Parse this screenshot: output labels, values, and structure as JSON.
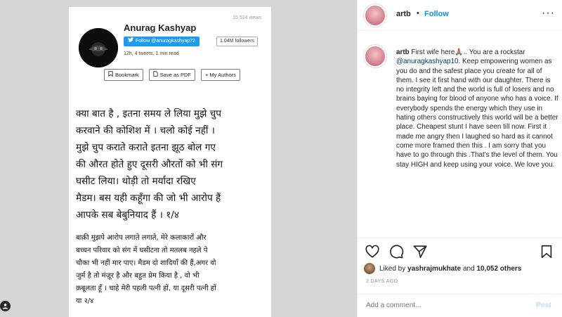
{
  "post_image": {
    "author_name": "Anurag Kashyap",
    "views": "15,524 views",
    "follow_label": "Follow @anuragkashyap72",
    "followers": "1.04M followers",
    "meta": "12h, 4 tweets, 1 min read",
    "bookmark": "Bookmark",
    "save_pdf": "Save as PDF",
    "my_authors": "+ My Authors",
    "hindi_main": [
      "क्या बात है , इतना समय ले लिया मुझे चुप",
      "करवाने की कोशिश में । चलो कोई नहीं ।",
      "मुझे चुप कराते कराते इतना झूठ बोल गए",
      "की औरत होते हुए दूसरी औरतों को भी संग",
      "घसीट लिया। थोड़ी तो मर्यादा रखिए",
      "मैडम। बस यही कहूँगा की जो भी आरोप हैं",
      "आपके सब बेबुनियाद हैं । १/४"
    ],
    "hindi_sub": [
      "बाक़ी मुझपे आरोप लगाते लगाते, मेरे कलाकारों और",
      "बच्चन परिवार को संग में घसीटना तो मतलब नहले पे",
      "चौका भी नहीं मार पाए। मैडम दो शादियाँ की हैं,अगर वो",
      "जुर्म है तो मंज़ूर है और बहुत प्रेम किया है , वो भी",
      "क़बूलता हूँ । चाहे मेरी पहली पत्नी हों, या दूसरी पत्नी हों",
      "या २/४"
    ]
  },
  "header": {
    "username": "artb",
    "dot": "•",
    "follow": "Follow",
    "more": "···"
  },
  "comment": {
    "username": "artb",
    "before_mention": "First wife here🙏🏽.. You are a rockstar ",
    "mention": "@anuragkashyap10",
    "after_mention": ". Keep empowering women as you do and the safest place you create for all of them. I see it first hand with our daughter. There is no integrity left and the world is full of losers and no brains baying for blood of anyone who has a voice. If everybody spends the energy which they use in hating others constructively this world will be a better place. Cheapest stunt I have seen till now. First it made me angry then I laughed so hard as it cannot come more framed then this . I am sorry that you have to go through this .That's the level of them. You stay HIGH and keep using your voice. We love you."
  },
  "likes": {
    "prefix": "Liked by",
    "user": "yashrajmukhate",
    "and": "and",
    "others": "10,052 others"
  },
  "posted_ago": "2 DAYS AGO",
  "add_comment": {
    "placeholder": "Add a comment...",
    "post_label": "Post"
  },
  "colors": {
    "accent": "#0095f6",
    "post_disabled": "#b2dffc",
    "twitter_blue": "#1d9bf0"
  }
}
